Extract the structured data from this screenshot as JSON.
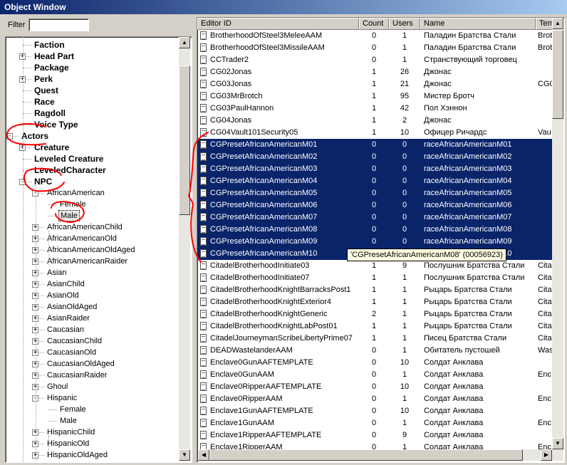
{
  "window": {
    "title": "Object Window"
  },
  "filter": {
    "label": "Filter",
    "value": ""
  },
  "tree": {
    "items": [
      {
        "label": "Faction",
        "bold": true
      },
      {
        "label": "Head Part",
        "bold": true,
        "expander": "+"
      },
      {
        "label": "Package",
        "bold": true
      },
      {
        "label": "Perk",
        "bold": true,
        "expander": "+"
      },
      {
        "label": "Quest",
        "bold": true
      },
      {
        "label": "Race",
        "bold": true
      },
      {
        "label": "Ragdoll",
        "bold": true
      },
      {
        "label": "Voice Type",
        "bold": true
      },
      {
        "label": "Actors",
        "bold": true,
        "expander": "−"
      },
      {
        "label": "Creature",
        "bold": true,
        "expander": "+"
      },
      {
        "label": "Leveled Creature",
        "bold": true
      },
      {
        "label": "LeveledCharacter",
        "bold": true
      },
      {
        "label": "NPC",
        "bold": true,
        "expander": "−"
      },
      {
        "label": "AfricanAmerican",
        "expander": "−"
      },
      {
        "label": "Female"
      },
      {
        "label": "Male",
        "selected": true
      },
      {
        "label": "AfricanAmericanChild",
        "expander": "+"
      },
      {
        "label": "AfricanAmericanOld",
        "expander": "+"
      },
      {
        "label": "AfricanAmericanOldAged",
        "expander": "+"
      },
      {
        "label": "AfricanAmericanRaider",
        "expander": "+"
      },
      {
        "label": "Asian",
        "expander": "+"
      },
      {
        "label": "AsianChild",
        "expander": "+"
      },
      {
        "label": "AsianOld",
        "expander": "+"
      },
      {
        "label": "AsianOldAged",
        "expander": "+"
      },
      {
        "label": "AsianRaider",
        "expander": "+"
      },
      {
        "label": "Caucasian",
        "expander": "+"
      },
      {
        "label": "CaucasianChild",
        "expander": "+"
      },
      {
        "label": "CaucasianOld",
        "expander": "+"
      },
      {
        "label": "CaucasianOldAged",
        "expander": "+"
      },
      {
        "label": "CaucasianRaider",
        "expander": "+"
      },
      {
        "label": "Ghoul",
        "expander": "+"
      },
      {
        "label": "Hispanic",
        "expander": "−"
      },
      {
        "label": "Female"
      },
      {
        "label": "Male"
      },
      {
        "label": "HispanicChild",
        "expander": "+"
      },
      {
        "label": "HispanicOld",
        "expander": "+"
      },
      {
        "label": "HispanicOldAged",
        "expander": "+"
      }
    ]
  },
  "list": {
    "columns": [
      "Editor ID",
      "Count",
      "Users",
      "Name",
      "Tem"
    ],
    "rows": [
      [
        "BrotherhoodOfSteel3MeleeAAM",
        "0",
        "1",
        "Паладин Братства Стали",
        "Brot"
      ],
      [
        "BrotherhoodOfSteel3MissileAAM",
        "0",
        "1",
        "Паладин Братства Стали",
        "Brot"
      ],
      [
        "CCTrader2",
        "0",
        "1",
        "Странствующий торговец",
        ""
      ],
      [
        "CG02Jonas",
        "1",
        "26",
        "Джонас",
        ""
      ],
      [
        "CG03Jonas",
        "1",
        "21",
        "Джонас",
        "CG0"
      ],
      [
        "CG03MrBrotch",
        "1",
        "95",
        "Мистер Бротч",
        ""
      ],
      [
        "CG03PaulHannon",
        "1",
        "42",
        "Пол Хэннон",
        ""
      ],
      [
        "CG04Jonas",
        "1",
        "2",
        "Джонас",
        ""
      ],
      [
        "CG04Vault101Security05",
        "1",
        "10",
        "Офицер Ричардс",
        "Vau"
      ],
      [
        "CGPresetAfricanAmericanM01",
        "0",
        "0",
        "raceAfricanAmericanM01",
        ""
      ],
      [
        "CGPresetAfricanAmericanM02",
        "0",
        "0",
        "raceAfricanAmericanM02",
        ""
      ],
      [
        "CGPresetAfricanAmericanM03",
        "0",
        "0",
        "raceAfricanAmericanM03",
        ""
      ],
      [
        "CGPresetAfricanAmericanM04",
        "0",
        "0",
        "raceAfricanAmericanM04",
        ""
      ],
      [
        "CGPresetAfricanAmericanM05",
        "0",
        "0",
        "raceAfricanAmericanM05",
        ""
      ],
      [
        "CGPresetAfricanAmericanM06",
        "0",
        "0",
        "raceAfricanAmericanM06",
        ""
      ],
      [
        "CGPresetAfricanAmericanM07",
        "0",
        "0",
        "raceAfricanAmericanM07",
        ""
      ],
      [
        "CGPresetAfricanAmericanM08",
        "0",
        "0",
        "raceAfricanAmericanM08",
        ""
      ],
      [
        "CGPresetAfricanAmericanM09",
        "0",
        "0",
        "raceAfricanAmericanM09",
        ""
      ],
      [
        "CGPresetAfricanAmericanM10",
        "0",
        "0",
        "raceAfricanAmericanM10",
        ""
      ],
      [
        "CitadelBrotherhoodInitiate03",
        "1",
        "9",
        "Послушник Братства Стали",
        "Cita"
      ],
      [
        "CitadelBrotherhoodInitiate07",
        "1",
        "1",
        "Послушник Братства Стали",
        "Cita"
      ],
      [
        "CitadelBrotherhoodKnightBarracksPost1",
        "1",
        "1",
        "Рыцарь Братства Стали",
        "Cita"
      ],
      [
        "CitadelBrotherhoodKnightExterior4",
        "1",
        "1",
        "Рыцарь Братства Стали",
        "Cita"
      ],
      [
        "CitadelBrotherhoodKnightGeneric",
        "2",
        "1",
        "Рыцарь Братства Стали",
        "Cita"
      ],
      [
        "CitadelBrotherhoodKnightLabPost01",
        "1",
        "1",
        "Рыцарь Братства Стали",
        "Cita"
      ],
      [
        "CitadelJourneymanScribeLibertyPrime07",
        "1",
        "1",
        "Писец Братства Стали",
        "Cita"
      ],
      [
        "DEADWastelanderAAM",
        "0",
        "1",
        "Обитатель пустошей",
        "Was"
      ],
      [
        "Enclave0GunAAFTEMPLATE",
        "0",
        "10",
        "Солдат Анклава",
        ""
      ],
      [
        "Enclave0GunAAM",
        "0",
        "1",
        "Солдат Анклава",
        "Enc"
      ],
      [
        "Enclave0RipperAAFTEMPLATE",
        "0",
        "10",
        "Солдат Анклава",
        ""
      ],
      [
        "Enclave0RipperAAM",
        "0",
        "1",
        "Солдат Анклава",
        "Enc"
      ],
      [
        "Enclave1GunAAFTEMPLATE",
        "0",
        "10",
        "Солдат Анклава",
        ""
      ],
      [
        "Enclave1GunAAM",
        "0",
        "1",
        "Солдат Анклава",
        "Enc"
      ],
      [
        "Enclave1RipperAAFTEMPLATE",
        "0",
        "9",
        "Солдат Анклава",
        ""
      ],
      [
        "Enclave1RipperAAM",
        "0",
        "1",
        "Солдат Анклава",
        "Enc"
      ]
    ],
    "selected_rows": [
      9,
      10,
      11,
      12,
      13,
      14,
      15,
      16,
      17,
      18
    ]
  },
  "tooltip": {
    "text": "'CGPresetAfricanAmericanM08' (00056923)"
  },
  "colors": {
    "selection": "#0a246a",
    "annotation": "#ff0000",
    "titlebar": "#0a246a"
  }
}
